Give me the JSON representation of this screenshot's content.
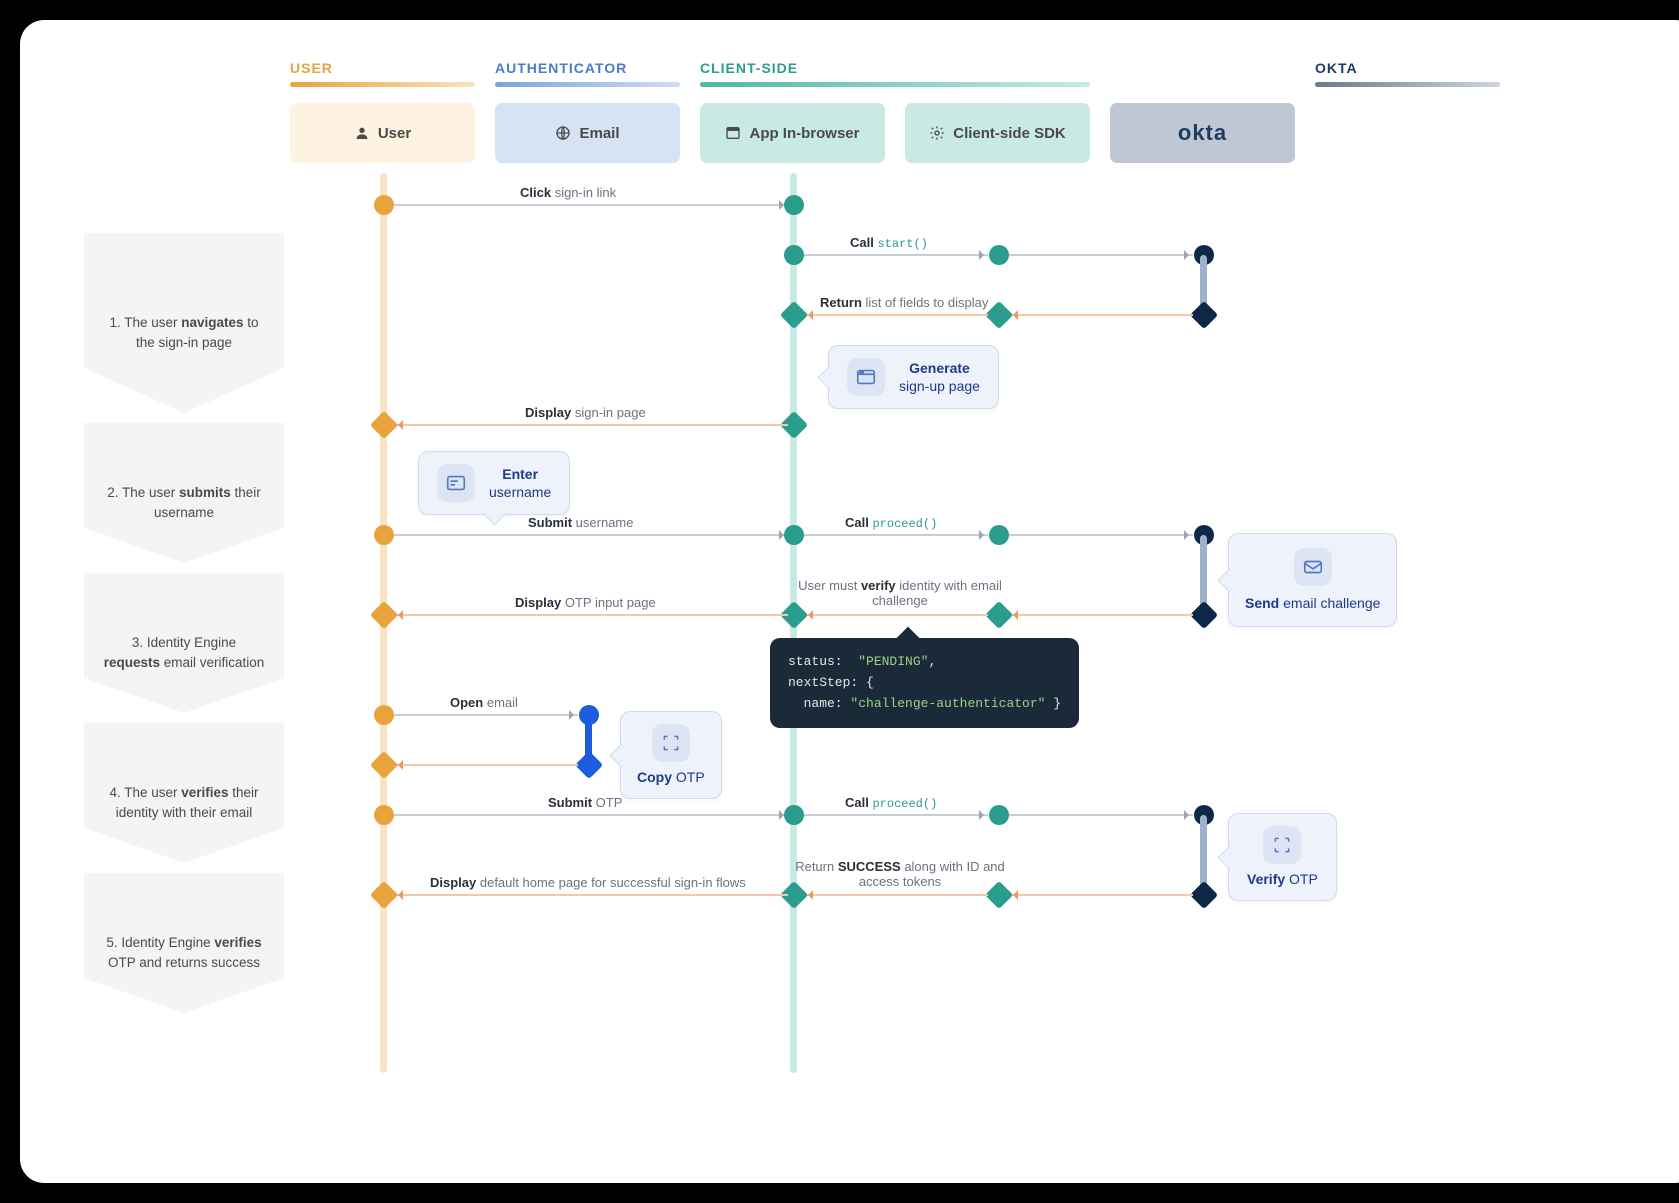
{
  "headers": {
    "user": "USER",
    "auth": "AUTHENTICATOR",
    "client": "CLIENT-SIDE",
    "okta": "OKTA"
  },
  "actors": {
    "user": "User",
    "email": "Email",
    "app": "App In-browser",
    "sdk": "Client-side SDK",
    "okta": "okta"
  },
  "steps": {
    "s1_pre": "1.  The user ",
    "s1_b": "navigates",
    "s1_post": " to the sign-in page",
    "s2_pre": "2. The user ",
    "s2_b": "submits",
    "s2_post": " their username",
    "s3_pre": "3. Identity Engine ",
    "s3_b": "requests",
    "s3_post": " email verification",
    "s4_pre": "4. The user ",
    "s4_b": "verifies",
    "s4_post": " their identity with their email",
    "s5_pre": "5. Identity Engine ",
    "s5_b": "verifies",
    "s5_post": " OTP and returns success"
  },
  "messages": {
    "m1_b": "Click",
    "m1": " sign-in link",
    "m2_b": "Call ",
    "m2_code": "start()",
    "m3_b": "Return",
    "m3": " list of fields to display",
    "m4_b": "Display",
    "m4": " sign-in page",
    "m5_b": "Submit",
    "m5": " username",
    "m6_b": "Call ",
    "m6_code": "proceed()",
    "m7_pre": "User must ",
    "m7_b": "verify",
    "m7_post": " identity with email challenge",
    "m8_b": "Display",
    "m8": " OTP input page",
    "m9_b": "Open",
    "m9": " email",
    "m10_b": "Submit",
    "m10": " OTP",
    "m11_b": "Call ",
    "m11_code": "proceed()",
    "m12_pre": "Return ",
    "m12_b": "SUCCESS",
    "m12_post": " along with ID and access tokens",
    "m13_b": "Display",
    "m13": " default home page for successful sign-in flows"
  },
  "callouts": {
    "c1_b": "Generate",
    "c1": "sign-up page",
    "c2_b": "Enter",
    "c2": "username",
    "c3_b": "Send",
    "c3": " email challenge",
    "c4_b": "Copy",
    "c4": " OTP",
    "c5_b": "Verify",
    "c5": " OTP"
  },
  "code": {
    "line1_k": "status:  ",
    "line1_v": "\"PENDING\"",
    "line1_e": ",",
    "line2": "nextStep: {",
    "line3_k": "  name: ",
    "line3_v": "\"challenge-authenticator\"",
    "line3_e": " }"
  },
  "chart_data": {
    "type": "sequence-diagram",
    "actors": [
      "User",
      "Email",
      "App In-browser",
      "Client-side SDK",
      "Okta"
    ],
    "groups": {
      "USER": [
        "User"
      ],
      "AUTHENTICATOR": [
        "Email"
      ],
      "CLIENT-SIDE": [
        "App In-browser",
        "Client-side SDK"
      ],
      "OKTA": [
        "Okta"
      ]
    },
    "messages": [
      {
        "from": "User",
        "to": "App In-browser",
        "label": "Click sign-in link",
        "kind": "call"
      },
      {
        "from": "App In-browser",
        "to": "Client-side SDK",
        "label": "Call start()",
        "kind": "call"
      },
      {
        "from": "Client-side SDK",
        "to": "Okta",
        "label": "",
        "kind": "call"
      },
      {
        "from": "Okta",
        "to": "App In-browser",
        "label": "Return list of fields to display",
        "kind": "return"
      },
      {
        "actor": "App In-browser",
        "note": "Generate sign-up page"
      },
      {
        "from": "App In-browser",
        "to": "User",
        "label": "Display sign-in page",
        "kind": "return"
      },
      {
        "actor": "User",
        "note": "Enter username"
      },
      {
        "from": "User",
        "to": "App In-browser",
        "label": "Submit username",
        "kind": "call"
      },
      {
        "from": "App In-browser",
        "to": "Client-side SDK",
        "label": "Call proceed()",
        "kind": "call"
      },
      {
        "from": "Client-side SDK",
        "to": "Okta",
        "label": "",
        "kind": "call"
      },
      {
        "actor": "Okta",
        "note": "Send email challenge"
      },
      {
        "from": "Okta",
        "to": "App In-browser",
        "label": "User must verify identity with email challenge",
        "kind": "return",
        "payload": {
          "status": "PENDING",
          "nextStep": {
            "name": "challenge-authenticator"
          }
        }
      },
      {
        "from": "App In-browser",
        "to": "User",
        "label": "Display OTP input page",
        "kind": "return"
      },
      {
        "from": "User",
        "to": "Email",
        "label": "Open email",
        "kind": "call"
      },
      {
        "actor": "Email",
        "note": "Copy OTP"
      },
      {
        "from": "Email",
        "to": "User",
        "label": "",
        "kind": "return"
      },
      {
        "from": "User",
        "to": "App In-browser",
        "label": "Submit OTP",
        "kind": "call"
      },
      {
        "from": "App In-browser",
        "to": "Client-side SDK",
        "label": "Call proceed()",
        "kind": "call"
      },
      {
        "from": "Client-side SDK",
        "to": "Okta",
        "label": "",
        "kind": "call"
      },
      {
        "actor": "Okta",
        "note": "Verify OTP"
      },
      {
        "from": "Okta",
        "to": "App In-browser",
        "label": "Return SUCCESS along with ID and access tokens",
        "kind": "return"
      },
      {
        "from": "App In-browser",
        "to": "User",
        "label": "Display default home page for successful sign-in flows",
        "kind": "return"
      }
    ],
    "steps": [
      "1. The user navigates to the sign-in page",
      "2. The user submits their username",
      "3. Identity Engine requests email verification",
      "4. The user verifies their identity with their email",
      "5. Identity Engine verifies OTP and returns success"
    ]
  }
}
